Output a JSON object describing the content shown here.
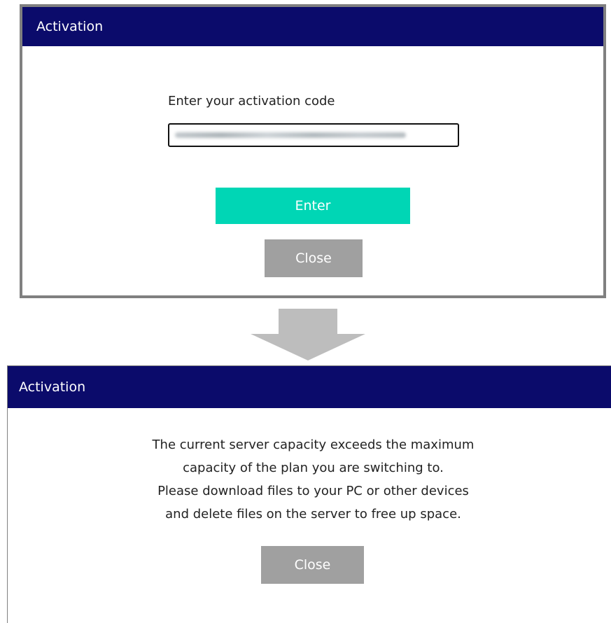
{
  "top_dialog": {
    "title": "Activation",
    "code_label": "Enter your activation code",
    "enter_label": "Enter",
    "close_label": "Close"
  },
  "bottom_dialog": {
    "title": "Activation",
    "message_lines": [
      "The current server capacity exceeds the maximum",
      "capacity of the plan you are switching to.",
      "Please download files to your PC or other devices",
      "and delete files on the server to free up space."
    ],
    "close_label": "Close"
  },
  "colors": {
    "titlebar": "#0b0b6b",
    "enter_button": "#00d6b5",
    "close_button": "#a0a0a0",
    "arrow": "#bdbdbd",
    "dialog_border": "#808080"
  },
  "icons": {
    "transition_arrow": "arrow-down-icon"
  }
}
